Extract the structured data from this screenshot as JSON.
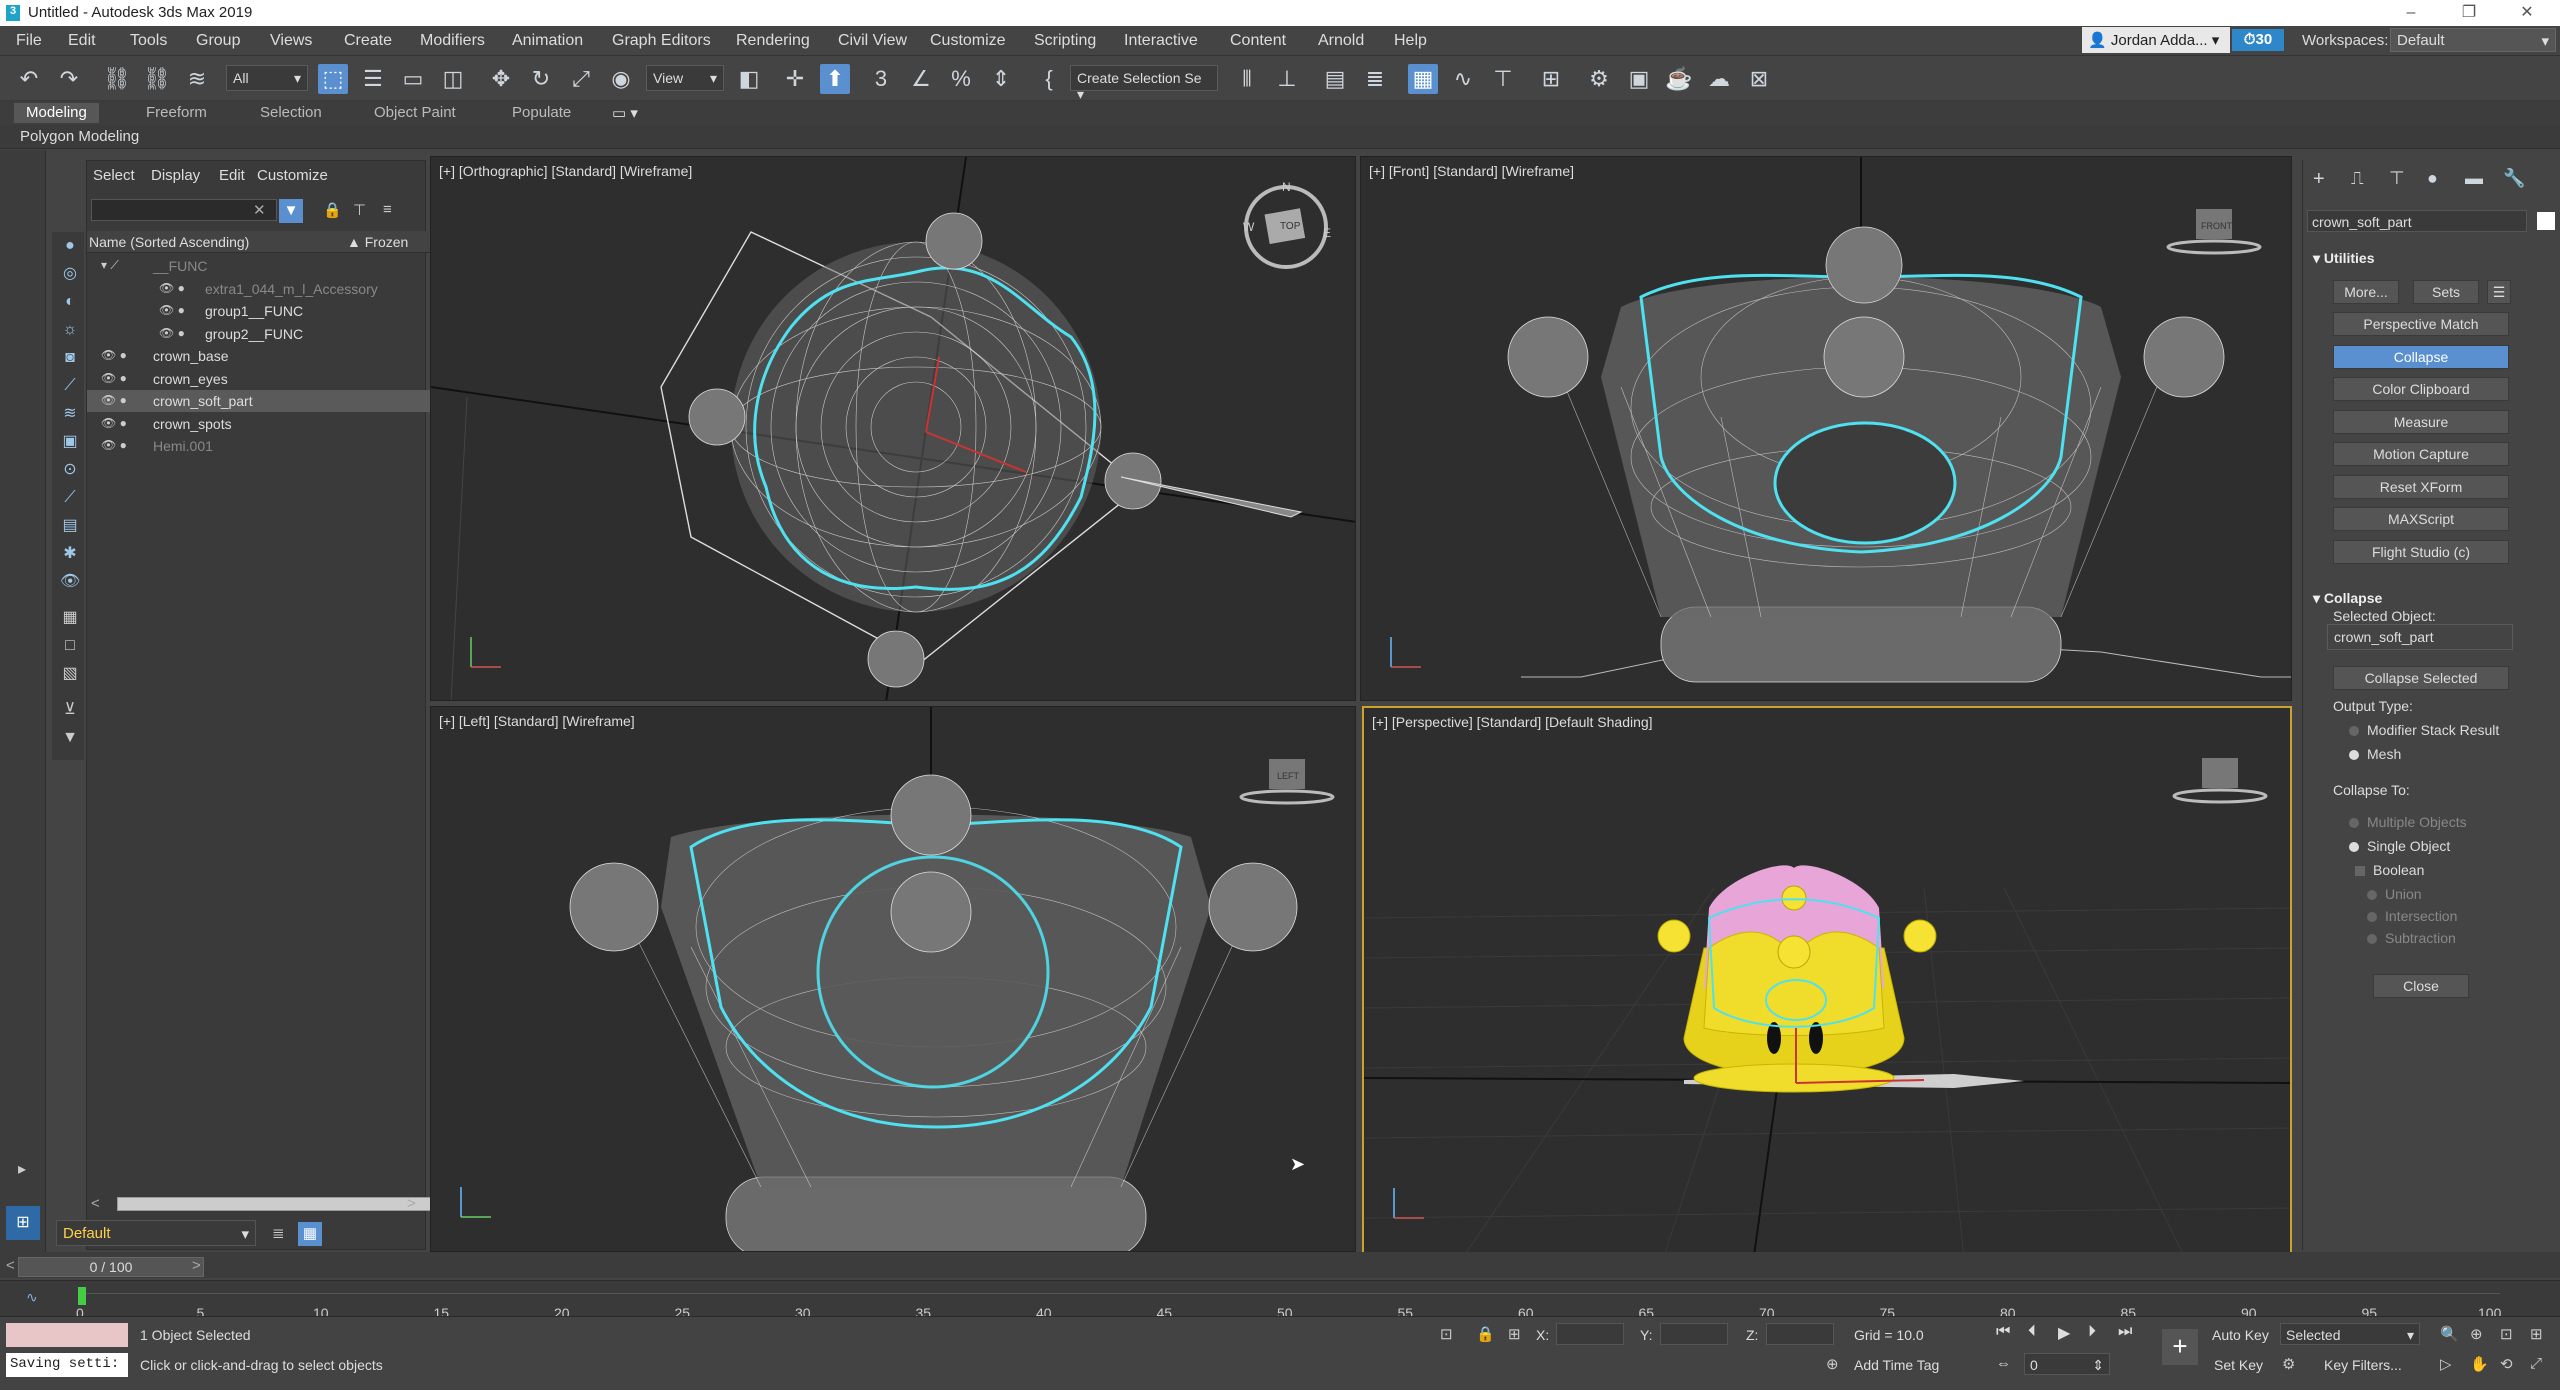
{
  "window": {
    "title": "Untitled - Autodesk 3ds Max 2019",
    "logo": "3"
  },
  "menu": [
    "File",
    "Edit",
    "Tools",
    "Group",
    "Views",
    "Create",
    "Modifiers",
    "Animation",
    "Graph Editors",
    "Rendering",
    "Civil View",
    "Customize",
    "Scripting",
    "Interactive",
    "Content",
    "Arnold",
    "Help"
  ],
  "user": {
    "name": "Jordan Adda...",
    "badge": "30"
  },
  "workspaces": {
    "label": "Workspaces:",
    "value": "Default"
  },
  "toolbar": {
    "filter": "All",
    "coord": "View",
    "selset": "Create Selection Se"
  },
  "ribbon": {
    "tabs": [
      "Modeling",
      "Freeform",
      "Selection",
      "Object Paint",
      "Populate"
    ],
    "active": "Modeling",
    "sub": "Polygon Modeling"
  },
  "scene": {
    "tabs": [
      "Select",
      "Display",
      "Edit",
      "Customize"
    ],
    "col_name": "Name (Sorted Ascending)",
    "col_frozen": "▲ Frozen",
    "rows": [
      {
        "name": "__FUNC",
        "indent": 0,
        "grey": true
      },
      {
        "name": "extra1_044_m_l_Accessory",
        "indent": 1,
        "grey": true
      },
      {
        "name": "group1__FUNC",
        "indent": 1,
        "grey": false
      },
      {
        "name": "group2__FUNC",
        "indent": 1,
        "grey": false
      },
      {
        "name": "crown_base",
        "indent": 0,
        "grey": false
      },
      {
        "name": "crown_eyes",
        "indent": 0,
        "grey": false
      },
      {
        "name": "crown_soft_part",
        "indent": 0,
        "grey": false,
        "selected": true
      },
      {
        "name": "crown_spots",
        "indent": 0,
        "grey": false
      },
      {
        "name": "Hemi.001",
        "indent": 0,
        "grey": true
      }
    ],
    "layer": "Default"
  },
  "viewports": {
    "top": "[+] [Orthographic] [Standard] [Wireframe]",
    "front": "[+] [Front] [Standard] [Wireframe]",
    "left": "[+] [Left] [Standard] [Wireframe]",
    "persp": "[+] [Perspective] [Standard] [Default Shading]",
    "cube_front": "FRONT",
    "cube_left": "LEFT",
    "cube_top": "TOP",
    "compass": [
      "N",
      "W",
      "E",
      "S"
    ]
  },
  "panel": {
    "object_name": "crown_soft_part",
    "utilities": "Utilities",
    "more": "More...",
    "sets": "Sets",
    "buttons": [
      "Perspective Match",
      "Collapse",
      "Color Clipboard",
      "Measure",
      "Motion Capture",
      "Reset XForm",
      "MAXScript",
      "Flight Studio (c)"
    ],
    "active_button": "Collapse",
    "collapse_title": "Collapse",
    "selected_object_label": "Selected Object:",
    "selected_object": "crown_soft_part",
    "collapse_selected": "Collapse Selected",
    "output_type": "Output Type:",
    "modifier_stack": "Modifier Stack Result",
    "mesh": "Mesh",
    "collapse_to": "Collapse To:",
    "multiple": "Multiple Objects",
    "single": "Single Object",
    "boolean": "Boolean",
    "union": "Union",
    "intersection": "Intersection",
    "subtraction": "Subtraction",
    "close": "Close"
  },
  "time": {
    "slider": "0 / 100",
    "ticks": [
      "0",
      "5",
      "10",
      "15",
      "20",
      "25",
      "30",
      "35",
      "40",
      "45",
      "50",
      "55",
      "60",
      "65",
      "70",
      "75",
      "80",
      "85",
      "90",
      "95",
      "100"
    ]
  },
  "status": {
    "script": "Saving setti:",
    "selected": "1 Object Selected",
    "prompt": "Click or click-and-drag to select objects",
    "x": "X:",
    "y": "Y:",
    "z": "Z:",
    "grid": "Grid = 10.0",
    "add_time_tag": "Add Time Tag",
    "auto_key": "Auto Key",
    "selected_dd": "Selected",
    "set_key": "Set Key",
    "key_filters": "Key Filters...",
    "frame": "0"
  }
}
